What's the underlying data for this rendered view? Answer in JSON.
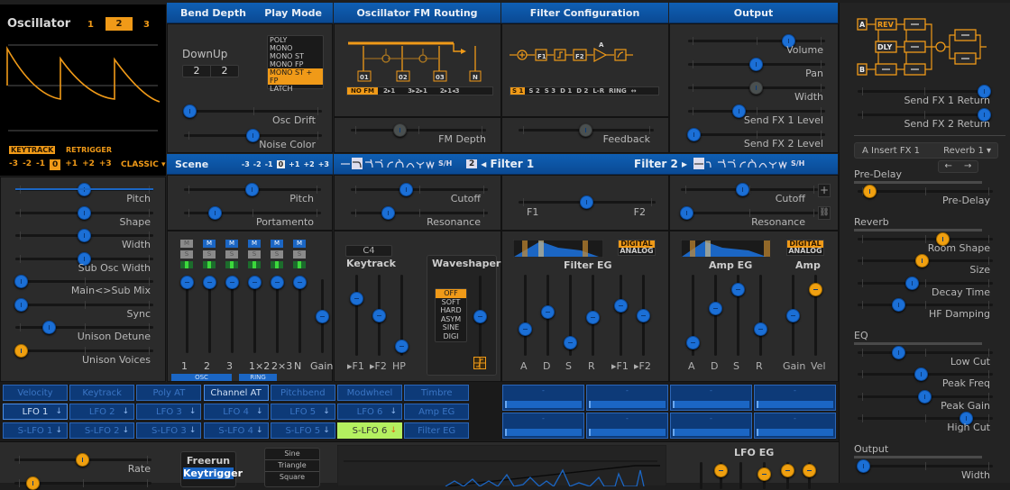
{
  "oscillator": {
    "title": "Oscillator",
    "tabs": [
      "1",
      "2",
      "3"
    ],
    "active_tab": "2",
    "keytrack": "KEYTRACK",
    "retrigger": "RETRIGGER",
    "octaves": [
      "-3",
      "-2",
      "-1",
      "0",
      "+1",
      "+2",
      "+3"
    ],
    "active_octave": "0",
    "mode": "CLASSIC ▾",
    "sliders": [
      {
        "label": "Pitch",
        "value": 0.5
      },
      {
        "label": "Shape",
        "value": 0.5
      },
      {
        "label": "Width",
        "value": 0.5
      },
      {
        "label": "Sub Osc Width",
        "value": 0.5
      },
      {
        "label": "Main<>Sub Mix",
        "value": 0.0
      },
      {
        "label": "Sync",
        "value": 0.0
      },
      {
        "label": "Unison Detune",
        "value": 0.22
      },
      {
        "label": "Unison Voices",
        "value": 0.0
      }
    ]
  },
  "bend": {
    "title": "Bend Depth",
    "down_label": "Down",
    "up_label": "Up",
    "down": "2",
    "up": "2"
  },
  "play_mode": {
    "title": "Play Mode",
    "options": [
      "POLY",
      "MONO",
      "MONO ST",
      "MONO FP",
      "MONO ST + FP",
      "LATCH"
    ],
    "selected": "MONO ST + FP"
  },
  "global": {
    "osc_drift": {
      "label": "Osc Drift",
      "value": 0.0
    },
    "noise_color": {
      "label": "Noise Color",
      "value": 0.5
    }
  },
  "fm_routing": {
    "title": "Oscillator FM Routing",
    "boxes": [
      "01",
      "02",
      "03",
      "N"
    ],
    "options": [
      "NO FM",
      "2▸1",
      "3▸2▸1",
      "2▸1◂3"
    ],
    "selected": "NO FM",
    "fm_depth": {
      "label": "FM Depth",
      "value": 0.35
    }
  },
  "filter_config": {
    "title": "Filter Configuration",
    "chain": [
      "F1",
      "F2",
      "A"
    ],
    "options": [
      "S 1",
      "S 2",
      "S 3",
      "D 1",
      "D 2",
      "L-R",
      "RING",
      "↔"
    ],
    "selected": "S 1",
    "feedback": {
      "label": "Feedback",
      "value": 0.5
    }
  },
  "output": {
    "title": "Output",
    "sliders": [
      {
        "label": "Volume",
        "value": 0.76
      },
      {
        "label": "Pan",
        "value": 0.5
      },
      {
        "label": "Width",
        "value": 0.5
      },
      {
        "label": "Send FX 1 Level",
        "value": 0.36
      },
      {
        "label": "Send FX 2 Level",
        "value": 0.0
      }
    ]
  },
  "scene": {
    "title": "Scene",
    "octaves": [
      "-3",
      "-2",
      "-1",
      "0",
      "+1",
      "+2",
      "+3"
    ],
    "active_octave": "0",
    "pitch": {
      "label": "Pitch",
      "value": 0.5
    },
    "portamento": {
      "label": "Portamento",
      "value": 0.2
    }
  },
  "filter_bar": {
    "filter_num": "2",
    "filter1": "◂ Filter 1",
    "filter2": "Filter 2 ▸",
    "types": "—⌐⌐⌐ ⌐⌐∩⋎ᴡ S/H"
  },
  "mixer": {
    "channels": [
      "1",
      "2",
      "3",
      "1×2",
      "2×3",
      "N",
      "Gain"
    ],
    "mute": "M",
    "solo": "S",
    "osc_label": "OSC",
    "ring_label": "RING",
    "levels": [
      1,
      1,
      1,
      1,
      1,
      1,
      0.5
    ]
  },
  "filter1": {
    "cutoff": {
      "label": "Cutoff",
      "value": 0.4
    },
    "resonance": {
      "label": "Resonance",
      "value": 0.25
    }
  },
  "filter_balance": {
    "left": "F1",
    "right": "F2",
    "value": 0.5
  },
  "filter2": {
    "cutoff": {
      "label": "Cutoff",
      "value": 0.45
    },
    "resonance": {
      "label": "Resonance",
      "value": 0.0
    },
    "plus": "+",
    "link": "⛓"
  },
  "keytrack": {
    "note": "C4",
    "title": "Keytrack",
    "labels": [
      "▸F1",
      "▸F2",
      "HP"
    ],
    "values": [
      0.75,
      0.5,
      0.05
    ]
  },
  "waveshaper": {
    "title": "Waveshaper",
    "options": [
      "OFF",
      "SOFT",
      "HARD",
      "ASYM",
      "SINE",
      "DIGI"
    ],
    "selected": "OFF",
    "value": 0.5
  },
  "filter_eg": {
    "title": "Filter EG",
    "mode_digital": "DIGITAL",
    "mode_analog": "ANALOG",
    "labels": [
      "A",
      "D",
      "S",
      "R",
      "▸F1",
      "▸F2"
    ],
    "values": [
      0.3,
      0.55,
      0.1,
      0.47,
      0.65,
      0.5
    ]
  },
  "amp_eg": {
    "title": "Amp EG",
    "amp_title": "Amp",
    "mode_digital": "DIGITAL",
    "mode_analog": "ANALOG",
    "labels": [
      "A",
      "D",
      "S",
      "R",
      "Gain",
      "Vel"
    ],
    "values": [
      0.1,
      0.6,
      0.88,
      0.3,
      0.5,
      0.88
    ]
  },
  "fx": {
    "send1_return": {
      "label": "Send FX 1 Return",
      "value": 1.0
    },
    "send2_return": {
      "label": "Send FX 2 Return",
      "value": 1.0
    },
    "slot": "A Insert FX 1",
    "preset": "Reverb 1 ▾",
    "prev": "←",
    "next": "→",
    "sections": [
      {
        "title": "Pre-Delay",
        "params": [
          {
            "label": "Pre-Delay",
            "value": 0.05,
            "color": "orange"
          }
        ]
      },
      {
        "title": "Reverb",
        "params": [
          {
            "label": "Room Shape",
            "value": 0.65,
            "color": "orange"
          },
          {
            "label": "Size",
            "value": 0.48,
            "color": "orange"
          },
          {
            "label": "Decay Time",
            "value": 0.4,
            "color": "blue"
          },
          {
            "label": "HF Damping",
            "value": 0.29,
            "color": "blue"
          }
        ]
      },
      {
        "title": "EQ",
        "params": [
          {
            "label": "Low Cut",
            "value": 0.29,
            "color": "blue"
          },
          {
            "label": "Peak Freq",
            "value": 0.47,
            "color": "blue"
          },
          {
            "label": "Peak Gain",
            "value": 0.5,
            "color": "blue"
          },
          {
            "label": "High Cut",
            "value": 0.84,
            "color": "blue"
          }
        ]
      },
      {
        "title": "Output",
        "params": [
          {
            "label": "Width",
            "value": 0.0,
            "color": "blue"
          }
        ]
      }
    ],
    "routing": {
      "a": "A",
      "b": "B",
      "rev": "REV",
      "dly": "DLY",
      "empty": "—"
    }
  },
  "modulation": {
    "row1": [
      "Velocity",
      "Keytrack",
      "Poly AT",
      "Channel AT",
      "Pitchbend",
      "Modwheel",
      "Timbre"
    ],
    "row2": [
      "LFO 1",
      "LFO 2",
      "LFO 3",
      "LFO 4",
      "LFO 5",
      "LFO 6",
      "Amp EG"
    ],
    "row3": [
      "S-LFO 1",
      "S-LFO 2",
      "S-LFO 3",
      "S-LFO 4",
      "S-LFO 5",
      "S-LFO 6",
      "Filter EG"
    ],
    "active_row1": "Channel AT",
    "active_row2": "LFO 1",
    "selected": "S-LFO 6",
    "macro_placeholder": "-"
  },
  "lfo": {
    "rate": {
      "label": "Rate",
      "value": 0.5
    },
    "phase_value": 0.1,
    "triggers": [
      "Freerun",
      "Keytrigger"
    ],
    "selected_trigger": "Keytrigger",
    "shapes": [
      "Sine",
      "Triangle",
      "Square"
    ],
    "eg_title": "LFO EG"
  }
}
